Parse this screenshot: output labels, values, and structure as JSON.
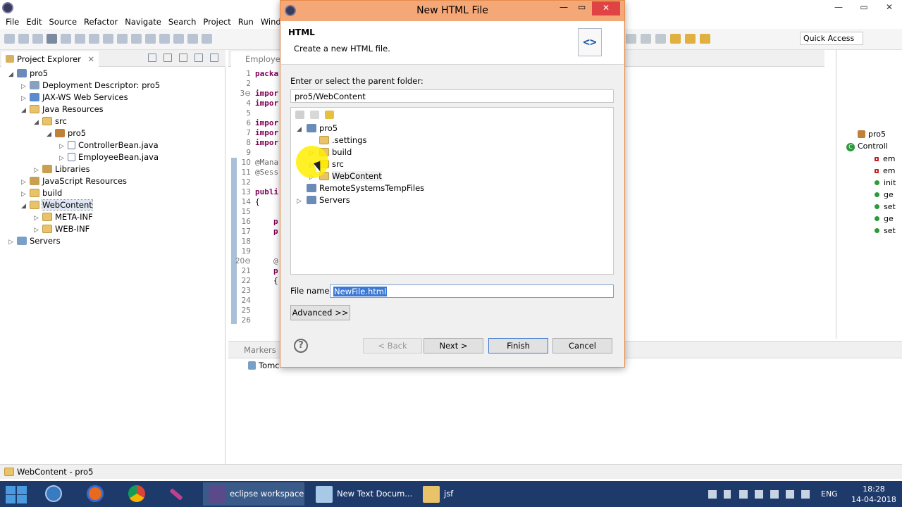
{
  "ide": {
    "menu": [
      "File",
      "Edit",
      "Source",
      "Refactor",
      "Navigate",
      "Search",
      "Project",
      "Run",
      "Window"
    ],
    "quick_access": "Quick Access",
    "window_controls": [
      "—",
      "▭",
      "✕"
    ]
  },
  "project_explorer": {
    "title": "Project Explorer",
    "close": "✕",
    "items": [
      {
        "label": "pro5",
        "icon": "project-icon"
      },
      {
        "label": "Deployment Descriptor: pro5",
        "icon": "descriptor-icon"
      },
      {
        "label": "JAX-WS Web Services",
        "icon": "webservices-icon"
      },
      {
        "label": "Java Resources",
        "icon": "folder-icon"
      },
      {
        "label": "src",
        "icon": "folder-icon"
      },
      {
        "label": "pro5",
        "icon": "package-icon"
      },
      {
        "label": "ControllerBean.java",
        "icon": "java-file-icon"
      },
      {
        "label": "EmployeeBean.java",
        "icon": "java-file-icon"
      },
      {
        "label": "Libraries",
        "icon": "library-icon"
      },
      {
        "label": "JavaScript Resources",
        "icon": "library-icon"
      },
      {
        "label": "build",
        "icon": "folder-icon"
      },
      {
        "label": "WebContent",
        "icon": "folder-open-icon"
      },
      {
        "label": "META-INF",
        "icon": "folder-icon"
      },
      {
        "label": "WEB-INF",
        "icon": "folder-icon"
      },
      {
        "label": "Servers",
        "icon": "servers-icon"
      }
    ]
  },
  "editor": {
    "tab": "Employee",
    "line_numbers": [
      "1",
      "2",
      "3⊖",
      "4",
      "5",
      "6",
      "7",
      "8",
      "9",
      "10",
      "11",
      "12",
      "13",
      "14",
      "15",
      "16",
      "17",
      "18",
      "19",
      "20⊖",
      "21",
      "22",
      "23",
      "24",
      "25",
      "26"
    ],
    "code": {
      "l1": "packa",
      "l3": "impor",
      "l4": "impor",
      "l6": "impor",
      "l7": "impor",
      "l8": "impor",
      "l10": "@Mana",
      "l11": "@Sess",
      "l13": "publi",
      "l14": "{",
      "l16": "p",
      "l17": "p",
      "l20": "@",
      "l21": "p",
      "l22": "{"
    }
  },
  "outline": {
    "items": [
      {
        "label": "pro5",
        "icon": "package-icon"
      },
      {
        "label": "Controll",
        "icon": "class-icon"
      },
      {
        "label": "em",
        "icon": "field-private-icon"
      },
      {
        "label": "em",
        "icon": "field-private-icon"
      },
      {
        "label": "init",
        "icon": "method-public-icon"
      },
      {
        "label": "ge",
        "icon": "method-public-icon"
      },
      {
        "label": "set",
        "icon": "method-public-icon"
      },
      {
        "label": "ge",
        "icon": "method-public-icon"
      },
      {
        "label": "set",
        "icon": "method-public-icon"
      }
    ]
  },
  "markers": {
    "tab": "Markers",
    "row": "Tomc"
  },
  "status_bar": {
    "text": "WebContent - pro5"
  },
  "dialog": {
    "title": "New HTML File",
    "header_title": "HTML",
    "header_subtitle": "Create a new HTML file.",
    "icon_glyph": "<>",
    "folder_label": "Enter or select the parent folder:",
    "folder_value": "pro5/WebContent",
    "tree": [
      {
        "label": "pro5",
        "twisty": "◢"
      },
      {
        "label": ".settings",
        "twisty": ""
      },
      {
        "label": "build",
        "twisty": "▷"
      },
      {
        "label": "src",
        "twisty": "▷"
      },
      {
        "label": "WebContent",
        "twisty": "▷"
      },
      {
        "label": "RemoteSystemsTempFiles",
        "twisty": ""
      },
      {
        "label": "Servers",
        "twisty": "▷"
      }
    ],
    "file_name_label": "File name:",
    "file_name_value": "NewFile.html",
    "advanced_button": "Advanced >>",
    "help_glyph": "?",
    "back_button": "< Back",
    "next_button": "Next >",
    "finish_button": "Finish",
    "cancel_button": "Cancel"
  },
  "taskbar": {
    "tasks": [
      {
        "label": "eclipse workspace...",
        "active": true
      },
      {
        "label": "New Text Docum...",
        "active": false
      },
      {
        "label": "jsf",
        "active": false
      }
    ],
    "lang": "ENG",
    "time": "18:28",
    "date": "14-04-2018"
  }
}
